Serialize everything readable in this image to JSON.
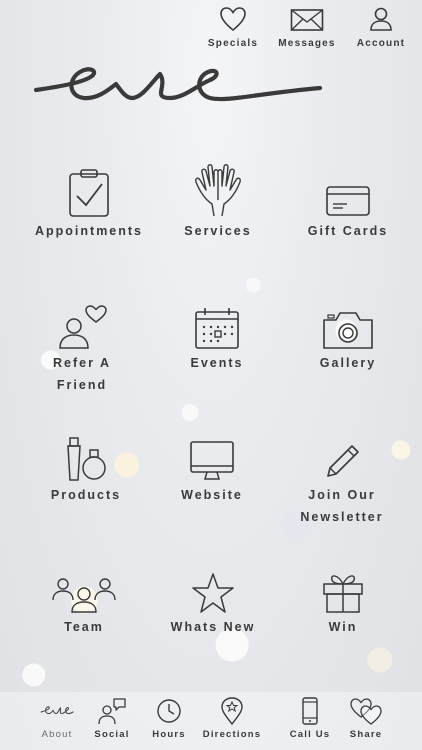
{
  "header": {
    "specials": "Specials",
    "messages": "Messages",
    "account": "Account",
    "logo_text": "eve"
  },
  "grid": {
    "appointments": "Appointments",
    "services": "Services",
    "gift_cards": "Gift Cards",
    "refer_a_friend_line1": "Refer A",
    "refer_a_friend_line2": "Friend",
    "events": "Events",
    "gallery": "Gallery",
    "products": "Products",
    "website": "Website",
    "newsletter_line1": "Join Our",
    "newsletter_line2": "Newsletter",
    "team": "Team",
    "whats_new": "Whats New",
    "win": "Win"
  },
  "tabbar": {
    "about_logo": "eve",
    "about": "About",
    "social": "Social",
    "hours": "Hours",
    "directions": "Directions",
    "call_us": "Call Us",
    "share": "Share"
  },
  "colors": {
    "icon_stroke": "#3a3a3a",
    "text": "#3a3a3a"
  }
}
